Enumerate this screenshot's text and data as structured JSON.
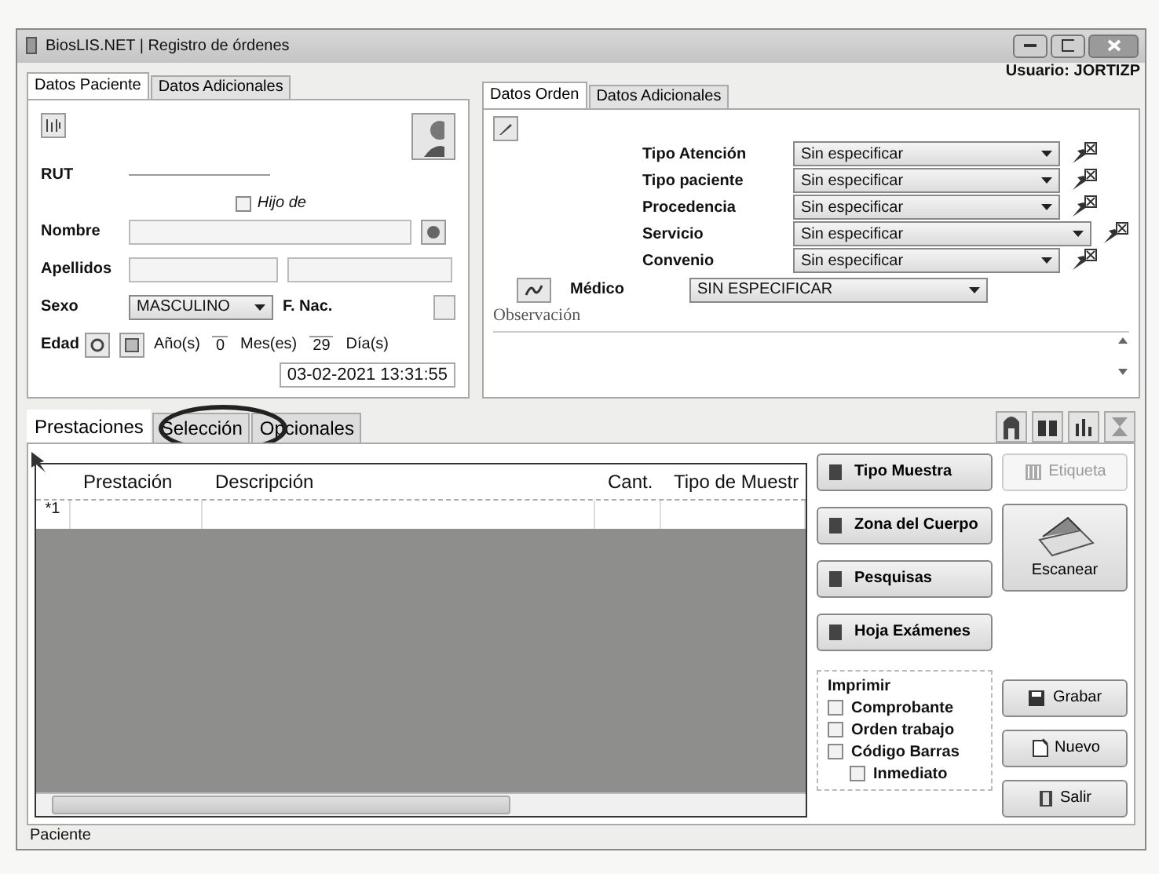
{
  "window": {
    "title": "BiosLIS.NET | Registro de órdenes",
    "user": "Usuario: JORTIZP"
  },
  "patient_panel": {
    "tabs": [
      {
        "label": "Datos Paciente",
        "selected": true
      },
      {
        "label": "Datos Adicionales",
        "selected": false
      }
    ],
    "rut_label": "RUT",
    "hijo_de": {
      "label": "Hijo de",
      "checked": false
    },
    "nombre_label": "Nombre",
    "apellidos_label": "Apellidos",
    "sexo_label": "Sexo",
    "sexo_value": "MASCULINO",
    "f_nac_label": "F. Nac.",
    "edad_label": "Edad",
    "age_parts": [
      {
        "kind": "unit",
        "text": "Año(s)"
      },
      {
        "kind": "value",
        "text": "0"
      },
      {
        "kind": "unit",
        "text": "Mes(es)"
      },
      {
        "kind": "value",
        "text": "29"
      },
      {
        "kind": "unit",
        "text": "Día(s)"
      }
    ],
    "timestamp": "03-02-2021 13:31:55"
  },
  "order_panel": {
    "tabs": [
      {
        "label": "Datos Orden",
        "selected": true
      },
      {
        "label": "Datos Adicionales",
        "selected": false
      }
    ],
    "fields": [
      {
        "label": "Tipo Atención",
        "value": "Sin especificar",
        "wide": false
      },
      {
        "label": "Tipo paciente",
        "value": "Sin especificar",
        "wide": false
      },
      {
        "label": "Procedencia",
        "value": "Sin especificar",
        "wide": false
      },
      {
        "label": "Servicio",
        "value": "Sin especificar",
        "wide": true
      },
      {
        "label": "Convenio",
        "value": "Sin especificar",
        "wide": false
      }
    ],
    "medico": {
      "label": "Médico",
      "value": "SIN ESPECIFICAR"
    },
    "observacion_label": "Observación"
  },
  "bottom_tabs": [
    {
      "label": "Prestaciones",
      "selected": true
    },
    {
      "label": "Selección",
      "selected": false
    },
    {
      "label": "Opcionales",
      "selected": false
    }
  ],
  "table": {
    "columns": [
      "Prestación",
      "Descripción",
      "Cant.",
      "Tipo de Muestr"
    ],
    "rows": [
      {
        "header": "*1"
      }
    ]
  },
  "action_buttons": [
    "Tipo Muestra",
    "Zona del Cuerpo",
    "Pesquisas",
    "Hoja Exámenes"
  ],
  "print_group": {
    "title": "Imprimir",
    "options": [
      {
        "label": "Comprobante",
        "checked": false
      },
      {
        "label": "Orden trabajo",
        "checked": false
      },
      {
        "label": "Código Barras",
        "checked": false,
        "children": [
          {
            "label": "Inmediato",
            "checked": false
          }
        ]
      }
    ]
  },
  "right_buttons": [
    {
      "label": "Etiqueta",
      "kind": "tag",
      "disabled": true
    },
    {
      "label": "Escanear",
      "kind": "scan",
      "disabled": false
    },
    {
      "label": "Grabar",
      "kind": "save",
      "disabled": false
    },
    {
      "label": "Nuevo",
      "kind": "new",
      "disabled": false
    },
    {
      "label": "Salir",
      "kind": "exit",
      "disabled": false
    }
  ],
  "status_bar": "Paciente"
}
